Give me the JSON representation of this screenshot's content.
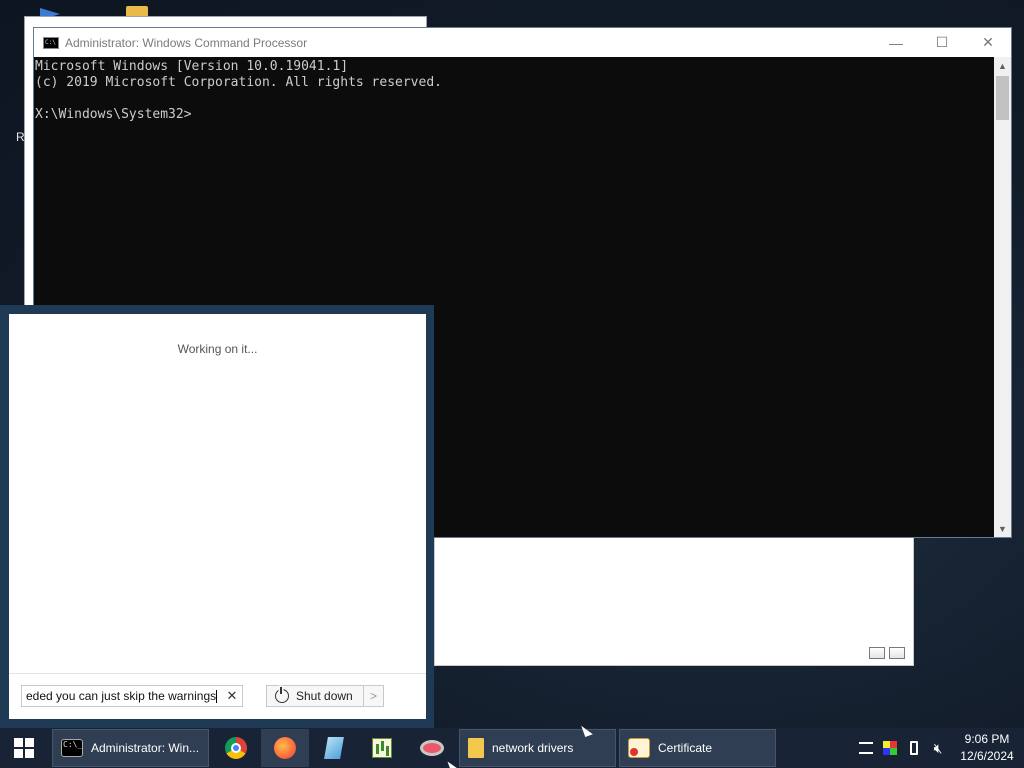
{
  "desktop": {
    "partial_label": "R"
  },
  "cmd_window": {
    "title": "Administrator: Windows Command Processor",
    "lines": [
      "Microsoft Windows [Version 10.0.19041.1]",
      "(c) 2019 Microsoft Corporation. All rights reserved.",
      "",
      "X:\\Windows\\System32>"
    ],
    "controls": {
      "minimize": "—",
      "maximize": "☐",
      "close": "✕"
    }
  },
  "start_menu": {
    "status": "Working on it...",
    "search_value": "eded you can just skip the warnings",
    "clear_glyph": "✕",
    "shutdown_label": "Shut down",
    "shutdown_arrow": ">"
  },
  "taskbar": {
    "cmd_task_label": "Administrator: Win...",
    "folder_task_label": "network drivers",
    "cert_task_label": "Certificate",
    "pinned": [
      "chrome-icon",
      "firefox-icon",
      "notepad-icon",
      "chart-app-icon",
      "paint-icon"
    ],
    "clock_time": "9:06 PM",
    "clock_date": "12/6/2024"
  }
}
